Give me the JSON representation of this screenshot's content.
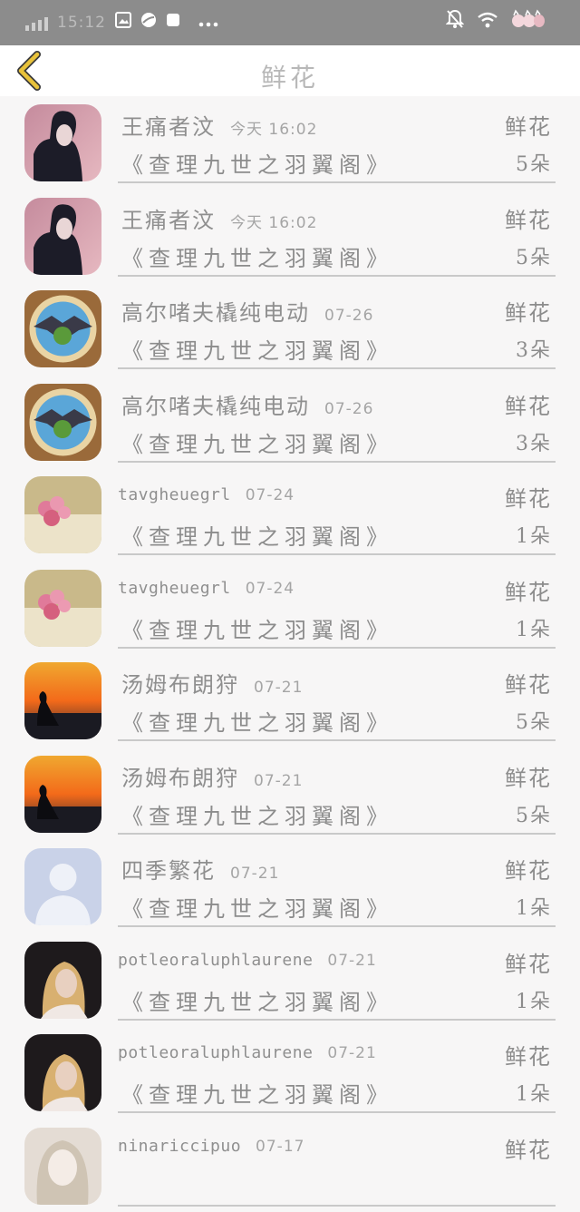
{
  "status_bar": {
    "time": "15:12",
    "left_icons": [
      "signal-icon",
      "image-icon",
      "browser-icon",
      "square-icon",
      "more-dots-icon"
    ],
    "right_icons": [
      "mute-notification-icon",
      "wifi-icon",
      "battery-cats-icon"
    ]
  },
  "header": {
    "title": "鲜花",
    "back_icon": "chevron-left-icon",
    "accent_color": "#e8c23a"
  },
  "records": [
    {
      "avatar": "dark-hair-person",
      "name": "王痛者汶",
      "date": "今天 16:02",
      "gift": "鲜花",
      "book": "《查理九世之羽翼阁》",
      "count": "5朵"
    },
    {
      "avatar": "dark-hair-person",
      "name": "王痛者汶",
      "date": "今天 16:02",
      "gift": "鲜花",
      "book": "《查理九世之羽翼阁》",
      "count": "5朵"
    },
    {
      "avatar": "dragon-badge",
      "name": "高尔啫夫橇纯电动",
      "date": "07-26",
      "gift": "鲜花",
      "book": "《查理九世之羽翼阁》",
      "count": "3朵"
    },
    {
      "avatar": "dragon-badge",
      "name": "高尔啫夫橇纯电动",
      "date": "07-26",
      "gift": "鲜花",
      "book": "《查理九世之羽翼阁》",
      "count": "3朵"
    },
    {
      "avatar": "pink-roses",
      "name": "tavgheuegrl",
      "date": "07-24",
      "gift": "鲜花",
      "book": "《查理九世之羽翼阁》",
      "count": "1朵"
    },
    {
      "avatar": "pink-roses",
      "name": "tavgheuegrl",
      "date": "07-24",
      "gift": "鲜花",
      "book": "《查理九世之羽翼阁》",
      "count": "1朵"
    },
    {
      "avatar": "sunset-silhouette",
      "name": "汤姆布朗狩",
      "date": "07-21",
      "gift": "鲜花",
      "book": "《查理九世之羽翼阁》",
      "count": "5朵"
    },
    {
      "avatar": "sunset-silhouette",
      "name": "汤姆布朗狩",
      "date": "07-21",
      "gift": "鲜花",
      "book": "《查理九世之羽翼阁》",
      "count": "5朵"
    },
    {
      "avatar": "default-user",
      "name": "四季繁花",
      "date": "07-21",
      "gift": "鲜花",
      "book": "《查理九世之羽翼阁》",
      "count": "1朵"
    },
    {
      "avatar": "blonde-woman",
      "name": "potleoraluphlaurene",
      "date": "07-21",
      "gift": "鲜花",
      "book": "《查理九世之羽翼阁》",
      "count": "1朵"
    },
    {
      "avatar": "blonde-woman",
      "name": "potleoraluphlaurene",
      "date": "07-21",
      "gift": "鲜花",
      "book": "《查理九世之羽翼阁》",
      "count": "1朵"
    },
    {
      "avatar": "anime-girl",
      "name": "ninariccipuo",
      "date": "07-17",
      "gift": "鲜花",
      "book": "",
      "count": ""
    }
  ]
}
